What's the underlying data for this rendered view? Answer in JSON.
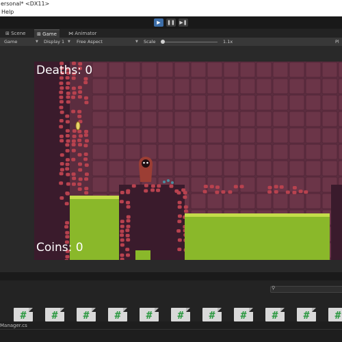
{
  "window": {
    "title": "ersonal* <DX11>"
  },
  "menu": {
    "help": "Help"
  },
  "toolbar": {
    "play_icon": "play-icon",
    "pause_icon": "pause-icon",
    "step_icon": "step-icon",
    "play_glyph": "▶",
    "pause_glyph": "❚❚",
    "step_glyph": "▶❚"
  },
  "tabs": {
    "scene": "⊞ Scene",
    "game": "⊞ Game",
    "animator": "⋈ Animator"
  },
  "game_toolbar": {
    "mode": "Game",
    "display": "Display 1",
    "aspect": "Free Aspect",
    "scale_label": "Scale",
    "scale_value": "1.1x",
    "right_label": "Pl"
  },
  "hud": {
    "deaths": "Deaths: 0",
    "coins": "Coins: 0"
  },
  "colors": {
    "background_tile": "#6b3548",
    "background_tile_edge": "#54283a",
    "wall": "#3a1b2c",
    "brick": "#b8424f",
    "grass": "#8ab82a",
    "grass_top": "#c4dc4a",
    "coin": "#e8d46a",
    "player_cloak": "#9c3e34",
    "accent_play": "#3d6ea8"
  },
  "project": {
    "search_placeholder": ""
  },
  "assets": {
    "file_icon": "csharp-script-icon",
    "file_glyph": "#",
    "count": 11
  },
  "footer": {
    "selected_file": "Manager.cs"
  }
}
